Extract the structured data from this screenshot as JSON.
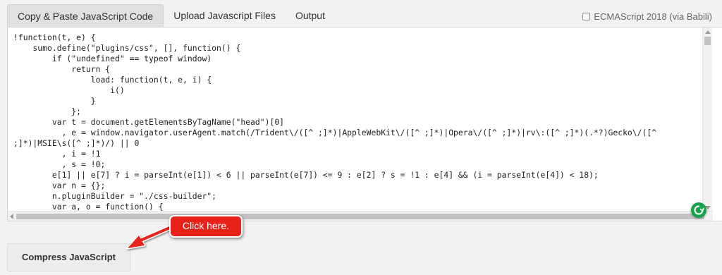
{
  "tabs": [
    {
      "label": "Copy & Paste JavaScript Code",
      "active": true
    },
    {
      "label": "Upload Javascript Files",
      "active": false
    },
    {
      "label": "Output",
      "active": false
    }
  ],
  "es_option": {
    "label": "ECMAScript 2018 (via Babili)",
    "checked": false
  },
  "editor": {
    "lines": [
      "!function(t, e) {",
      "    sumo.define(\"plugins/css\", [], function() {",
      "        if (\"undefined\" == typeof window)",
      "            return {",
      "                load: function(t, e, i) {",
      "                    i()",
      "                }",
      "            };",
      "        var t = document.getElementsByTagName(\"head\")[0]",
      "          , e = window.navigator.userAgent.match(/Trident\\/([^ ;]*)|AppleWebKit\\/([^ ;]*)|Opera\\/([^ ;]*)|rv\\:([^ ;]*)(.*?)Gecko\\/([^",
      ";]*)|MSIE\\s([^ ;]*)/) || 0",
      "          , i = !1",
      "          , s = !0;",
      "        e[1] || e[7] ? i = parseInt(e[1]) < 6 || parseInt(e[7]) <= 9 : e[2] ? s = !1 : e[4] && (i = parseInt(e[4]) < 18);",
      "        var n = {};",
      "        n.pluginBuilder = \"./css-builder\";",
      "        var a, o = function() {"
    ]
  },
  "compress_button": {
    "label": "Compress JavaScript"
  },
  "callout": {
    "label": "Click here.",
    "color": "#e8211b"
  },
  "icons": {
    "grammar": "grammar-check-icon",
    "checkbox": "checkbox-icon"
  }
}
